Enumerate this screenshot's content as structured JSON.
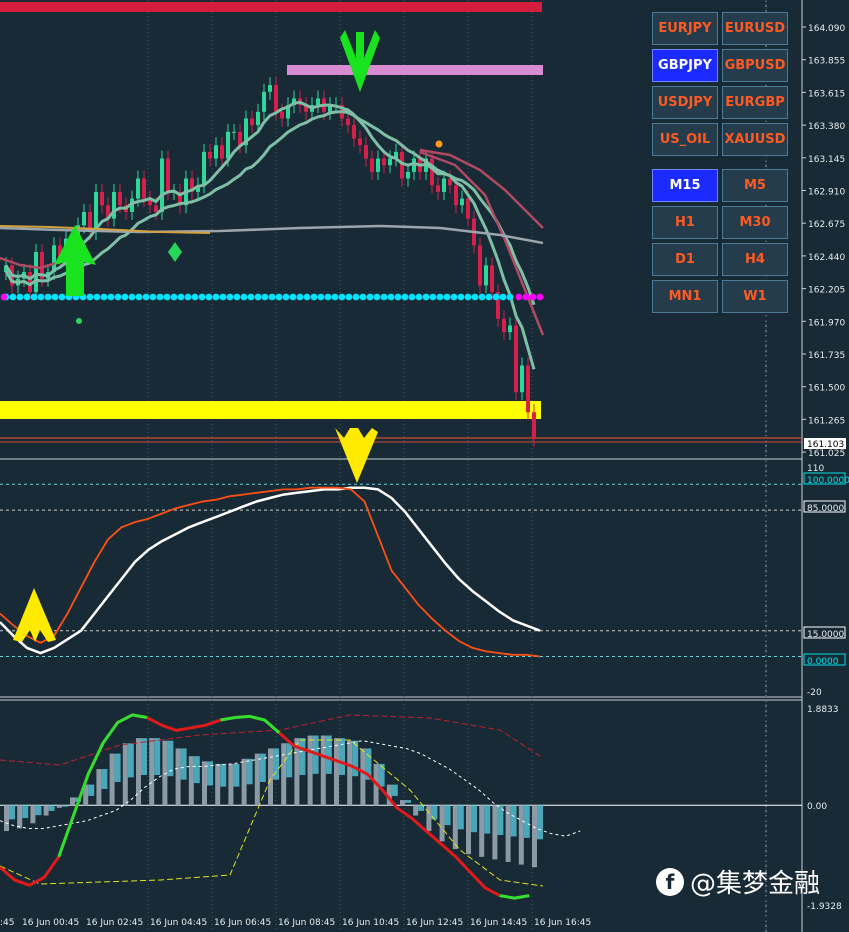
{
  "chart_data": [
    {
      "type": "candlestick",
      "symbol": "GBPJPY",
      "timeframe": "M15",
      "price_levels": [
        "164.090",
        "163.855",
        "163.615",
        "163.380",
        "163.145",
        "162.910",
        "162.675",
        "162.440",
        "162.205",
        "161.970",
        "161.735",
        "161.500",
        "161.265",
        "161.025"
      ],
      "last_price": "161.103",
      "ylim": [
        160.98,
        164.2
      ],
      "ohlc_close": [
        162.4,
        162.25,
        162.3,
        162.35,
        162.2,
        162.5,
        162.3,
        162.35,
        162.55,
        162.45,
        162.6,
        162.55,
        162.7,
        162.8,
        162.65,
        162.95,
        162.85,
        162.75,
        162.95,
        162.85,
        162.8,
        162.9,
        163.05,
        162.9,
        162.85,
        162.8,
        163.2,
        162.95,
        162.95,
        162.85,
        163.05,
        162.95,
        163.0,
        163.25,
        163.2,
        163.3,
        163.2,
        163.4,
        163.4,
        163.3,
        163.5,
        163.45,
        163.55,
        163.7,
        163.75,
        163.55,
        163.5,
        163.6,
        163.65,
        163.6,
        163.55,
        163.6,
        163.65,
        163.55,
        163.6,
        163.6,
        163.5,
        163.45,
        163.35,
        163.3,
        163.2,
        163.1,
        163.2,
        163.15,
        163.2,
        163.25,
        163.05,
        163.1,
        163.2,
        163.1,
        163.2,
        163.0,
        162.95,
        163.05,
        163.0,
        162.85,
        162.9,
        162.75,
        162.55,
        162.25,
        162.4,
        162.2,
        162.0,
        161.9,
        161.95,
        161.45,
        161.65,
        161.3,
        161.1
      ],
      "colors": {
        "bull": "#2fd79a",
        "bear": "#d4204a"
      },
      "annotations": [
        "buy-arrow",
        "sell-arrow",
        "diamond",
        "support-zone",
        "resistance-zone"
      ]
    },
    {
      "type": "line",
      "name": "stochastic",
      "y_levels": [
        "110",
        "100.0000",
        "85.0000",
        "15.0000",
        "0.0000",
        "-20"
      ],
      "ylim": [
        -20,
        110
      ],
      "white_line": [
        20,
        12,
        5,
        2,
        5,
        10,
        15,
        25,
        35,
        45,
        55,
        62,
        67,
        71,
        75,
        78,
        81,
        84,
        87,
        90,
        92,
        94,
        95,
        96,
        97,
        97,
        98,
        98,
        97,
        92,
        84,
        74,
        64,
        54,
        45,
        38,
        32,
        26,
        21,
        18,
        15
      ],
      "orange_line": [
        25,
        18,
        12,
        8,
        12,
        25,
        40,
        55,
        68,
        75,
        78,
        80,
        83,
        86,
        88,
        90,
        91,
        93,
        94,
        95,
        96,
        97,
        97,
        98,
        98,
        98,
        97,
        90,
        70,
        50,
        40,
        30,
        22,
        15,
        9,
        5,
        3,
        2,
        1,
        1,
        0
      ]
    },
    {
      "type": "histogram",
      "name": "macd",
      "y_levels": [
        "1.8833",
        "0.00",
        "-1.9328"
      ],
      "ylim": [
        -1.9328,
        1.8833
      ],
      "histogram": [
        -0.5,
        -0.45,
        -0.35,
        -0.2,
        -0.05,
        0.15,
        0.4,
        0.7,
        1.0,
        1.2,
        1.3,
        1.3,
        1.25,
        1.1,
        0.95,
        0.85,
        0.8,
        0.8,
        0.9,
        1.0,
        1.1,
        1.2,
        1.3,
        1.35,
        1.35,
        1.3,
        1.25,
        1.1,
        0.8,
        0.4,
        0.1,
        -0.2,
        -0.5,
        -0.7,
        -0.85,
        -0.95,
        -1.0,
        -1.05,
        -1.1,
        -1.15,
        -1.2
      ],
      "signal_line": [
        -0.3,
        -0.4,
        -0.45,
        -0.45,
        -0.4,
        -0.35,
        -0.3,
        -0.2,
        -0.1,
        0.1,
        0.35,
        0.55,
        0.7,
        0.75,
        0.75,
        0.78,
        0.8,
        0.85,
        0.9,
        0.95,
        1.0,
        1.05,
        1.1,
        1.15,
        1.2,
        1.25,
        1.2,
        1.15,
        1.1,
        1.0,
        0.85,
        0.7,
        0.5,
        0.3,
        0.05,
        -0.15,
        -0.3,
        -0.45,
        -0.55,
        -0.6,
        -0.5
      ],
      "main_line": [
        -1.2,
        -1.45,
        -1.55,
        -1.4,
        -1.0,
        -0.2,
        0.6,
        1.2,
        1.6,
        1.75,
        1.7,
        1.55,
        1.45,
        1.5,
        1.55,
        1.65,
        1.7,
        1.72,
        1.65,
        1.4,
        1.15,
        1.05,
        0.95,
        0.85,
        0.75,
        0.6,
        0.3,
        -0.05,
        -0.25,
        -0.5,
        -0.75,
        -1.0,
        -1.3,
        -1.6,
        -1.75,
        -1.8,
        -1.75
      ],
      "x_labels": [
        ":45",
        "16 Jun 00:45",
        "16 Jun 02:45",
        "16 Jun 04:45",
        "16 Jun 06:45",
        "16 Jun 08:45",
        "16 Jun 10:45",
        "16 Jun 12:45",
        "16 Jun 14:45",
        "16 Jun 16:45"
      ]
    }
  ],
  "symbols": [
    "EURJPY",
    "EURUSD",
    "GBPJPY",
    "GBPUSD",
    "USDJPY",
    "EURGBP",
    "US_OIL",
    "XAUUSD"
  ],
  "timeframes": [
    "M15",
    "M5",
    "H1",
    "M30",
    "D1",
    "H4",
    "MN1",
    "W1"
  ],
  "active_symbol": "GBPJPY",
  "active_timeframe": "M15",
  "watermark": "@集梦金融"
}
